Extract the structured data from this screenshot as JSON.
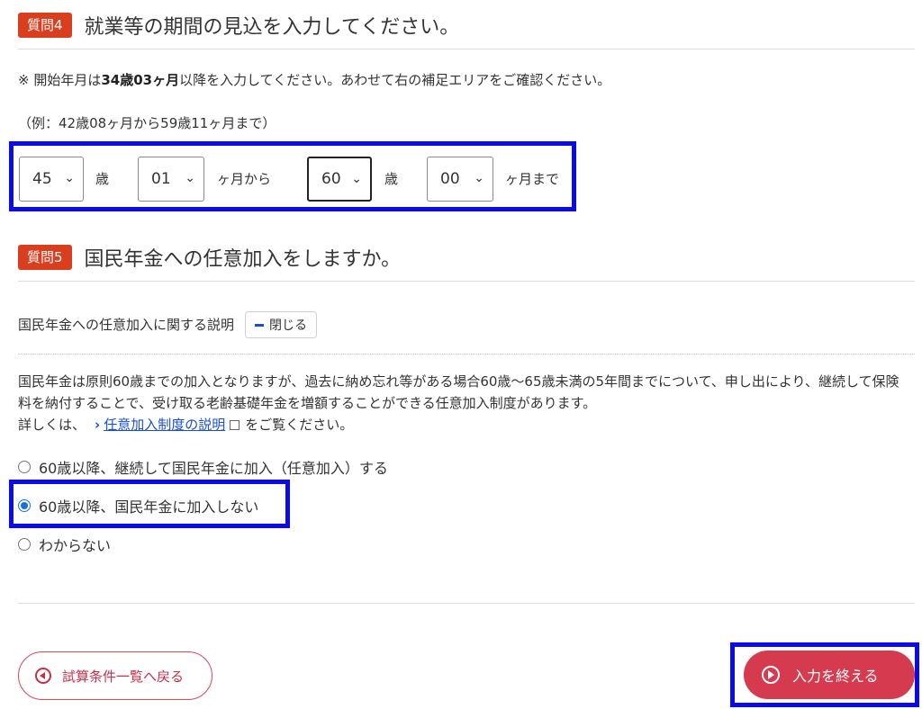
{
  "q4": {
    "badge": "質問4",
    "title": "就業等の期間の見込を入力してください。",
    "note_prefix": "※ 開始年月は",
    "note_bold": "34歳03ヶ月",
    "note_suffix": "以降を入力してください。あわせて右の補足エリアをご確認ください。",
    "example": "（例：42歳08ヶ月から59歳11ヶ月まで）",
    "selects": {
      "start_age": "45",
      "start_month": "01",
      "end_age": "60",
      "end_month": "00"
    },
    "units": {
      "age1": "歳",
      "month_from": "ヶ月から",
      "age2": "歳",
      "month_to": "ヶ月まで"
    }
  },
  "q5": {
    "badge": "質問5",
    "title": "国民年金への任意加入をしますか。",
    "explanation_label": "国民年金への任意加入に関する説明",
    "close_label": "閉じる",
    "paragraph": "国民年金は原則60歳までの加入となりますが、過去に納め忘れ等がある場合60歳〜65歳未満の5年間までについて、申し出により、継続して保険料を納付することで、受け取る老齢基礎年金を増額することができる任意加入制度があります。",
    "detail_prefix": "詳しくは、",
    "link_text": "任意加入制度の説明",
    "detail_suffix": "をご覧ください。",
    "options": [
      {
        "label": "60歳以降、継続して国民年金に加入（任意加入）する",
        "checked": false
      },
      {
        "label": "60歳以降、国民年金に加入しない",
        "checked": true
      },
      {
        "label": "わからない",
        "checked": false
      }
    ]
  },
  "footer": {
    "back_label": "試算条件一覧へ戻る",
    "finish_label": "入力を終える"
  },
  "colors": {
    "badge": "#d93f1e",
    "highlight": "#0b0bea",
    "finish": "#d63a4e",
    "link": "#1a4fd1"
  }
}
